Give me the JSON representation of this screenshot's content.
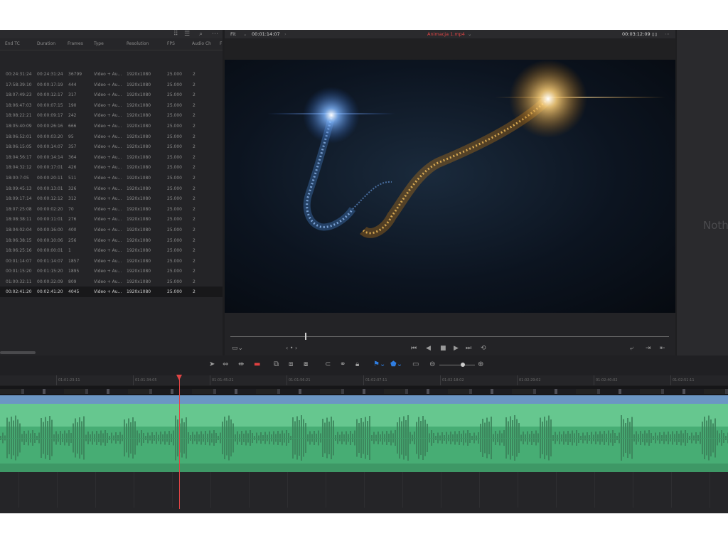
{
  "media_pool": {
    "icons": [
      "thumbnail-grid-icon",
      "list-view-icon",
      "search-icon",
      "more-icon"
    ],
    "columns": [
      "End TC",
      "Duration",
      "Frames",
      "Type",
      "Resolution",
      "FPS",
      "Audio Ch",
      "F"
    ],
    "rows": [
      [
        "00:24:31:24",
        "00:24:31:24",
        "36799",
        "Video + Au...",
        "1920x1080",
        "25.000",
        "2"
      ],
      [
        "17:58:39:10",
        "00:00:17:19",
        "444",
        "Video + Au...",
        "1920x1080",
        "25.000",
        "2"
      ],
      [
        "18:07:49:23",
        "00:00:12:17",
        "317",
        "Video + Au...",
        "1920x1080",
        "25.000",
        "2"
      ],
      [
        "18:06:47:03",
        "00:00:07:15",
        "190",
        "Video + Au...",
        "1920x1080",
        "25.000",
        "2"
      ],
      [
        "18:08:22:21",
        "00:00:09:17",
        "242",
        "Video + Au...",
        "1920x1080",
        "25.000",
        "2"
      ],
      [
        "18:05:40:09",
        "00:00:26:16",
        "666",
        "Video + Au...",
        "1920x1080",
        "25.000",
        "2"
      ],
      [
        "18:06:52:01",
        "00:00:03:20",
        "95",
        "Video + Au...",
        "1920x1080",
        "25.000",
        "2"
      ],
      [
        "18:06:15:05",
        "00:00:14:07",
        "357",
        "Video + Au...",
        "1920x1080",
        "25.000",
        "2"
      ],
      [
        "18:04:56:17",
        "00:00:14:14",
        "364",
        "Video + Au...",
        "1920x1080",
        "25.000",
        "2"
      ],
      [
        "18:04:32:12",
        "00:00:17:01",
        "426",
        "Video + Au...",
        "1920x1080",
        "25.000",
        "2"
      ],
      [
        "18:00:7:05",
        "00:00:20:11",
        "511",
        "Video + Au...",
        "1920x1080",
        "25.000",
        "2"
      ],
      [
        "18:09:45:13",
        "00:00:13:01",
        "326",
        "Video + Au...",
        "1920x1080",
        "25.000",
        "2"
      ],
      [
        "18:09:17:14",
        "00:00:12:12",
        "312",
        "Video + Au...",
        "1920x1080",
        "25.000",
        "2"
      ],
      [
        "18:07:25:08",
        "00:00:02:20",
        "70",
        "Video + Au...",
        "1920x1080",
        "25.000",
        "2"
      ],
      [
        "18:08:38:11",
        "00:00:11:01",
        "276",
        "Video + Au...",
        "1920x1080",
        "25.000",
        "2"
      ],
      [
        "18:04:02:04",
        "00:00:16:00",
        "400",
        "Video + Au...",
        "1920x1080",
        "25.000",
        "2"
      ],
      [
        "18:06:38:15",
        "00:00:10:06",
        "256",
        "Video + Au...",
        "1920x1080",
        "25.000",
        "2"
      ],
      [
        "18:06:25:16",
        "00:00:00:01",
        "1",
        "Video + Au...",
        "1920x1080",
        "25.000",
        "2"
      ],
      [
        "00:01:14:07",
        "00:01:14:07",
        "1857",
        "Video + Au...",
        "1920x1080",
        "25.000",
        "2"
      ],
      [
        "00:01:15:20",
        "00:01:15:20",
        "1895",
        "Video + Au...",
        "1920x1080",
        "25.000",
        "2"
      ],
      [
        "01:00:32:11",
        "00:00:32:09",
        "809",
        "Video + Au...",
        "1920x1080",
        "25.000",
        "2"
      ],
      [
        "00:02:41:20",
        "00:02:41:20",
        "4045",
        "Video + Au...",
        "1920x1080",
        "25.000",
        "2"
      ]
    ],
    "selected_row": 21
  },
  "viewer": {
    "zoom": "Fit",
    "source_timecode": "00:01:14:07",
    "clip_name": "Animacja 1.mp4",
    "timeline_timecode": "00:03:12:09",
    "scrub_fraction": 0.17
  },
  "inspector": {
    "empty_text": "Noth"
  },
  "timeline": {
    "ruler": [
      "01:01:23:11",
      "01:01:34:05",
      "01:01:45:21",
      "01:01:56:21",
      "01:02:07:11",
      "01:02:18:02",
      "01:02:29:02",
      "01:02:40:02",
      "01:02:51:11"
    ]
  },
  "colors": {
    "playhead": "#e04545",
    "video_clip": "#6b96c4",
    "audio_clip": "#47ad74",
    "flag_marker": "#2f7de0",
    "clip_name": "#e04545"
  }
}
